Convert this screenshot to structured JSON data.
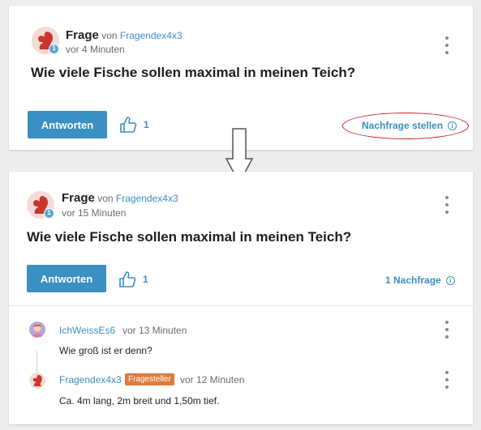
{
  "top_card": {
    "type_label": "Frage",
    "by_label": "von",
    "author": "Fragendex4x3",
    "time": "vor 4 Minuten",
    "badge": "1",
    "question": "Wie viele Fische sollen maximal in meinen Teich?",
    "answer_button": "Antworten",
    "like_count": "1",
    "followup_link": "Nachfrage stellen",
    "info_glyph": "i"
  },
  "bottom_card": {
    "type_label": "Frage",
    "by_label": "von",
    "author": "Fragendex4x3",
    "time": "vor 15 Minuten",
    "badge": "1",
    "question": "Wie viele Fische sollen maximal in meinen Teich?",
    "answer_button": "Antworten",
    "like_count": "1",
    "followup_count": "1 Nachfrage",
    "info_glyph": "i",
    "comments": [
      {
        "user": "IchWeissEs6",
        "time": "vor 13 Minuten",
        "text": "Wie groß ist er denn?"
      },
      {
        "user": "Fragendex4x3",
        "tag": "Fragesteller",
        "time": "vor 12 Minuten",
        "text": "Ca. 4m lang, 2m breit und 1,50m tief."
      }
    ]
  },
  "colors": {
    "accent": "#3a8fc3",
    "highlight": "#c0262c",
    "tag": "#e07b39"
  },
  "icons": [
    "squirrel-avatar-icon",
    "thumbs-up-icon",
    "info-icon",
    "more-options-icon",
    "down-arrow-icon",
    "user-avatar-icon"
  ]
}
